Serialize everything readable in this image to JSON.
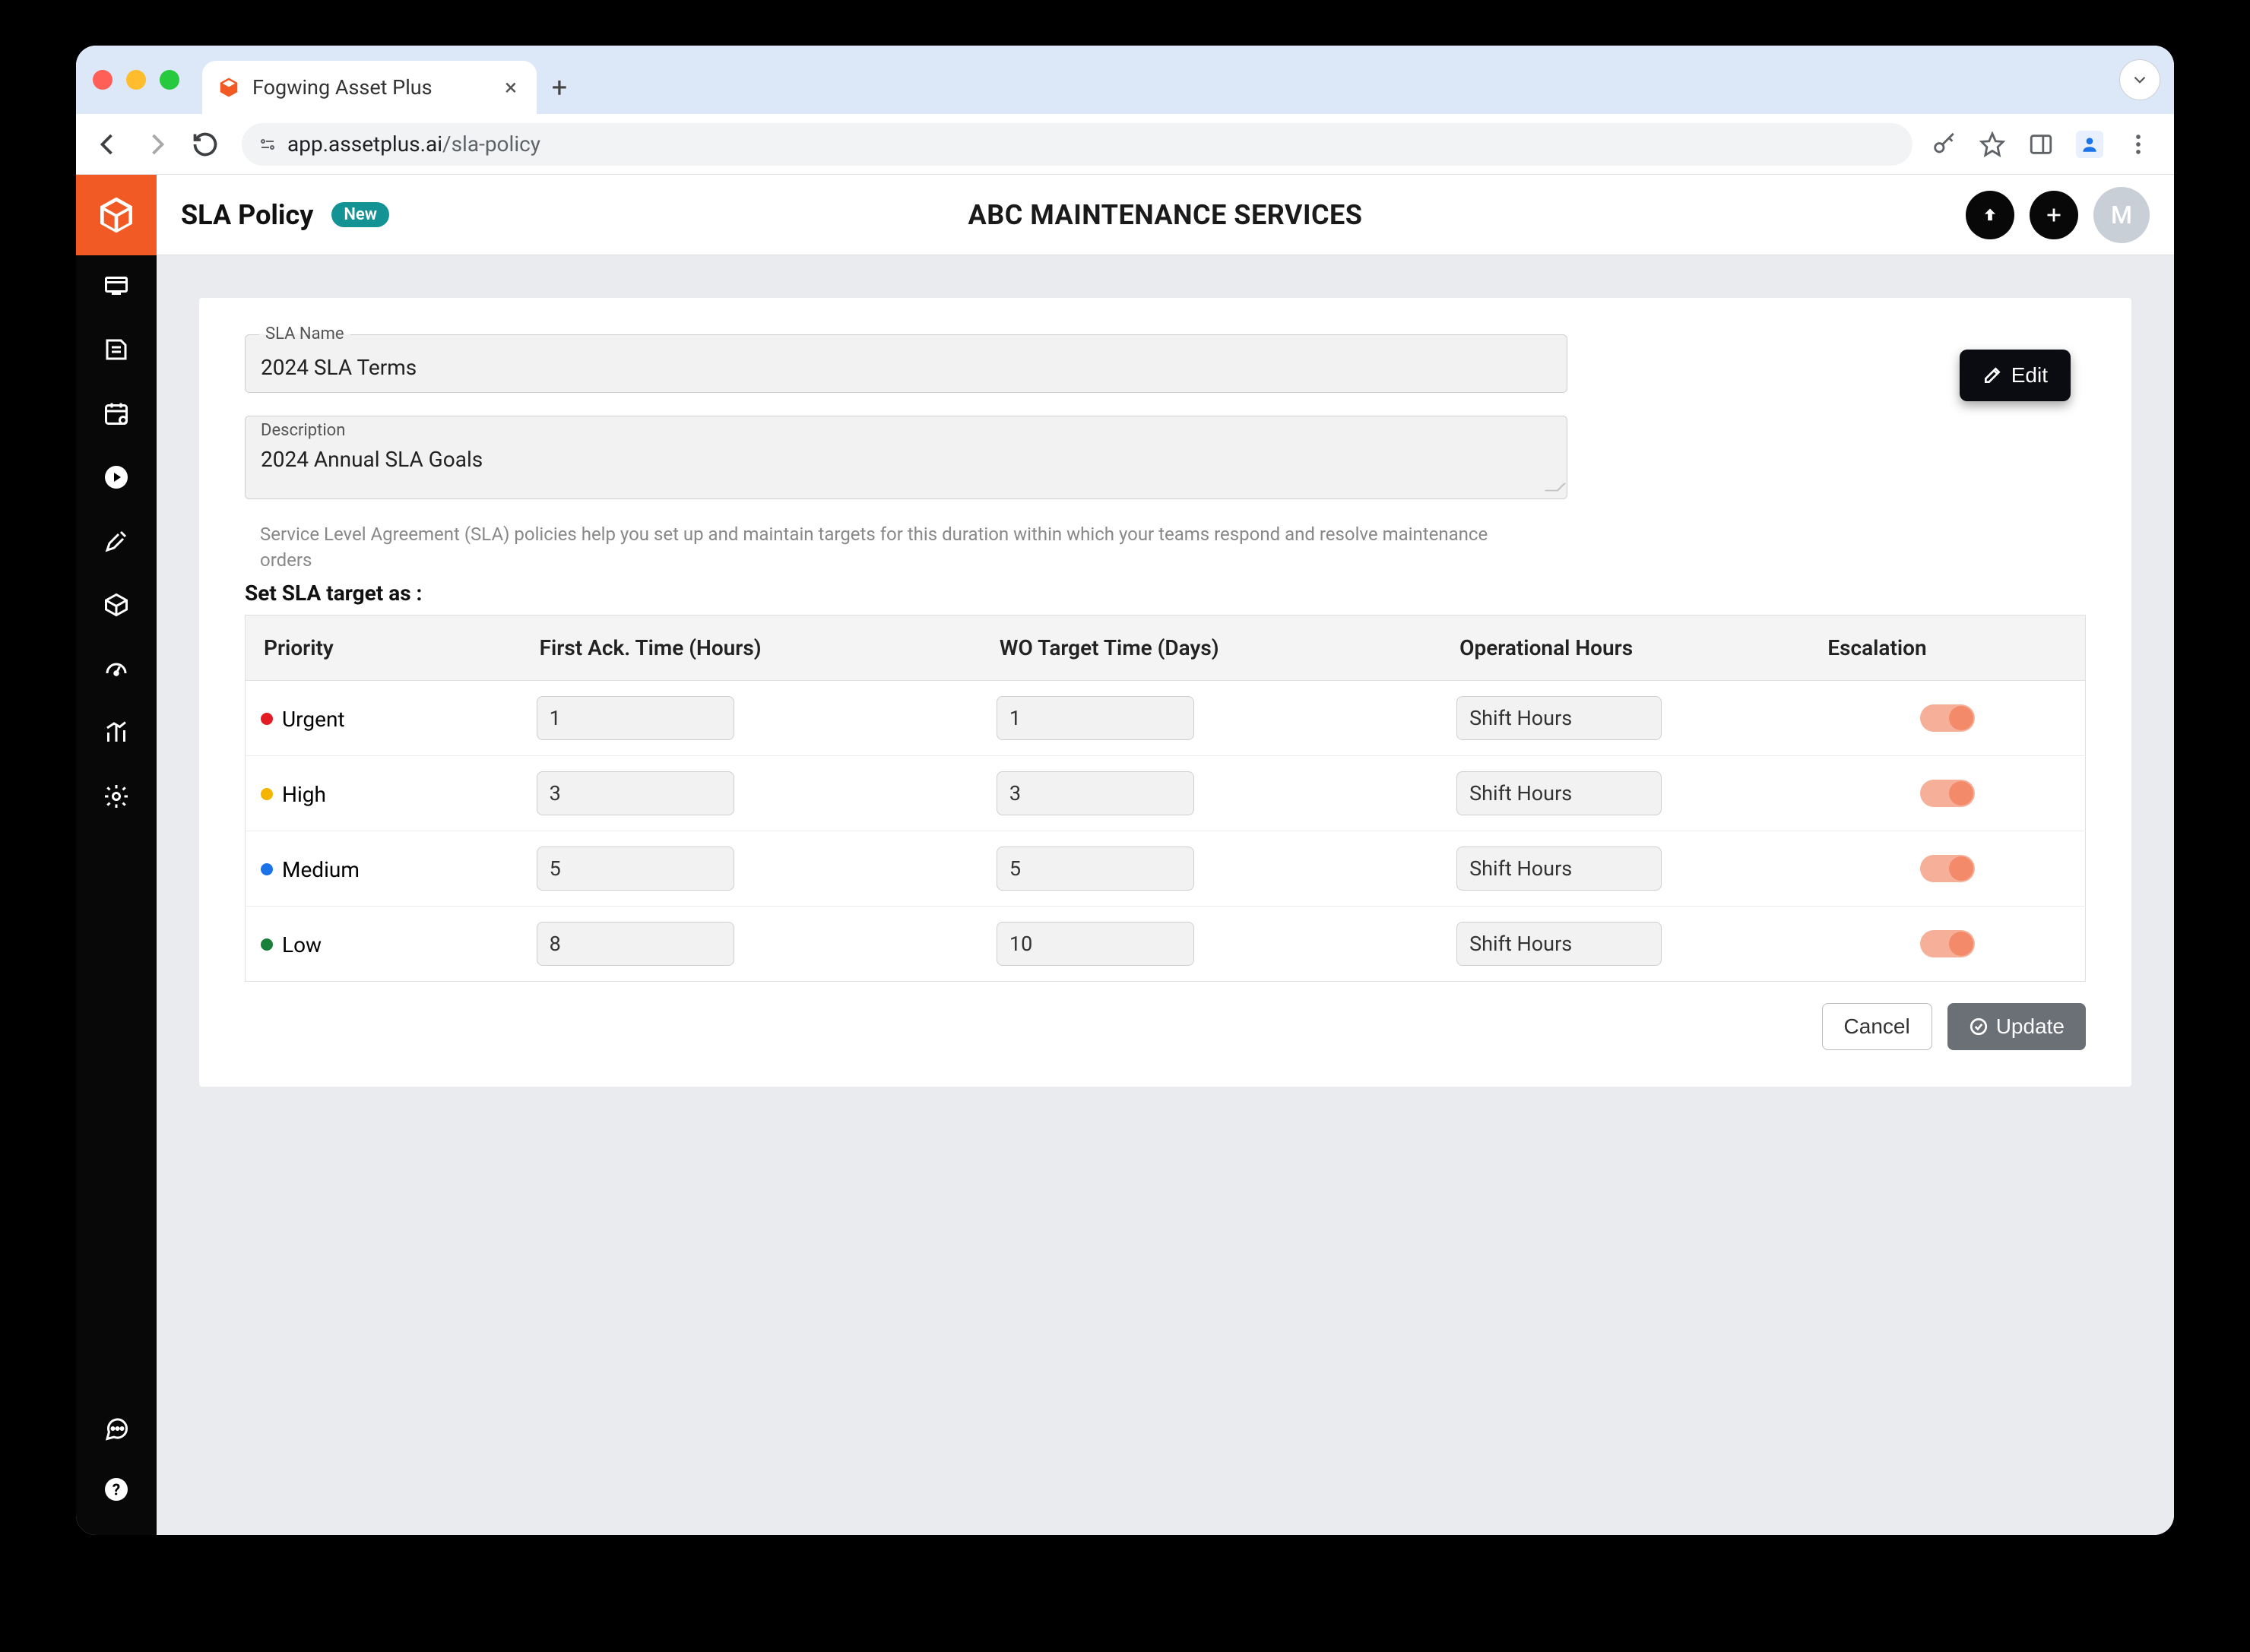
{
  "browser": {
    "tab_title": "Fogwing Asset Plus",
    "url_domain": "app.assetplus.ai",
    "url_path": "/sla-policy"
  },
  "header": {
    "page_title": "SLA Policy",
    "badge": "New",
    "org": "ABC MAINTENANCE SERVICES",
    "avatar_letter": "M"
  },
  "sidebar": {
    "items": [
      {
        "name": "dashboard-icon"
      },
      {
        "name": "workorders-icon"
      },
      {
        "name": "calendar-icon"
      },
      {
        "name": "media-icon"
      },
      {
        "name": "tools-icon"
      },
      {
        "name": "inventory-icon"
      },
      {
        "name": "gauge-icon"
      },
      {
        "name": "analytics-icon"
      },
      {
        "name": "settings-icon"
      }
    ],
    "bottom": [
      {
        "name": "chat-icon"
      },
      {
        "name": "help-icon"
      }
    ]
  },
  "form": {
    "name_label": "SLA Name",
    "name_value": "2024 SLA Terms",
    "desc_label": "Description",
    "desc_value": "2024 Annual SLA Goals",
    "helper": "Service Level Agreement (SLA) policies help you set up and maintain targets for this duration within which your teams respond and resolve maintenance orders",
    "section_title": "Set SLA target as :",
    "edit_label": "Edit"
  },
  "table": {
    "headers": {
      "priority": "Priority",
      "ack": "First Ack. Time (Hours)",
      "target": "WO Target Time (Days)",
      "op": "Operational Hours",
      "esc": "Escalation"
    },
    "rows": [
      {
        "priority": "Urgent",
        "dot": "dot-urgent",
        "ack": "1",
        "target": "1",
        "op": "Shift Hours",
        "esc": true
      },
      {
        "priority": "High",
        "dot": "dot-high",
        "ack": "3",
        "target": "3",
        "op": "Shift Hours",
        "esc": true
      },
      {
        "priority": "Medium",
        "dot": "dot-medium",
        "ack": "5",
        "target": "5",
        "op": "Shift Hours",
        "esc": true
      },
      {
        "priority": "Low",
        "dot": "dot-low",
        "ack": "8",
        "target": "10",
        "op": "Shift Hours",
        "esc": true
      }
    ]
  },
  "actions": {
    "cancel": "Cancel",
    "update": "Update"
  }
}
